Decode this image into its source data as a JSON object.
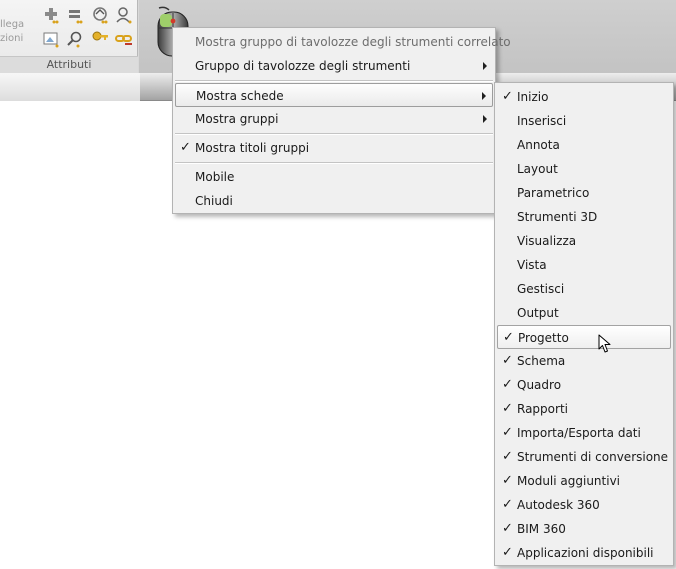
{
  "ribbon": {
    "big_button_label_line1": "llega",
    "big_button_label_line2": "zioni",
    "group_caption": "Attributi"
  },
  "main_menu": {
    "items": [
      {
        "label": "Mostra gruppo di tavolozze degli strumenti correlato",
        "enabled": false
      },
      {
        "label": "Gruppo di tavolozze degli strumenti",
        "submenu": true
      },
      {
        "label": "Mostra schede",
        "submenu": true,
        "highlighted": true
      },
      {
        "label": "Mostra gruppi",
        "submenu": true
      },
      {
        "label": "Mostra titoli gruppi",
        "checked": true
      },
      {
        "label": "Mobile"
      },
      {
        "label": "Chiudi"
      }
    ]
  },
  "tabs_submenu": {
    "items": [
      {
        "label": "Inizio",
        "checked": true
      },
      {
        "label": "Inserisci",
        "checked": false
      },
      {
        "label": "Annota",
        "checked": false
      },
      {
        "label": "Layout",
        "checked": false
      },
      {
        "label": "Parametrico",
        "checked": false
      },
      {
        "label": "Strumenti 3D",
        "checked": false
      },
      {
        "label": "Visualizza",
        "checked": false
      },
      {
        "label": "Vista",
        "checked": false
      },
      {
        "label": "Gestisci",
        "checked": false
      },
      {
        "label": "Output",
        "checked": false
      },
      {
        "label": "Progetto",
        "checked": true,
        "hovered": true
      },
      {
        "label": "Schema",
        "checked": true
      },
      {
        "label": "Quadro",
        "checked": true
      },
      {
        "label": "Rapporti",
        "checked": true
      },
      {
        "label": "Importa/Esporta dati",
        "checked": true
      },
      {
        "label": "Strumenti di conversione",
        "checked": true
      },
      {
        "label": "Moduli aggiuntivi",
        "checked": true
      },
      {
        "label": "Autodesk 360",
        "checked": true
      },
      {
        "label": "BIM 360",
        "checked": true
      },
      {
        "label": "Applicazioni disponibili",
        "checked": true
      }
    ]
  },
  "check_glyph": "✓",
  "colors": {
    "menu_background": "#f0f0f0",
    "menu_border": "#b3b3b3",
    "disabled_text": "#6d6d6d",
    "ribbon_grey": "#c8c8c8"
  }
}
